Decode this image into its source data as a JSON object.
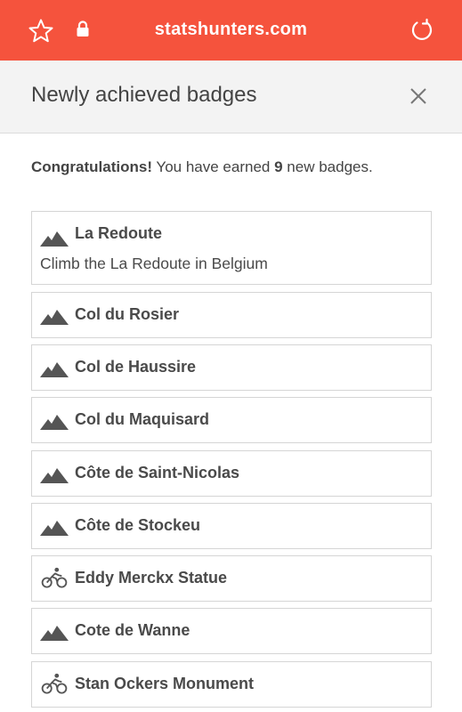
{
  "browser": {
    "url": "statshunters.com",
    "accent_color": "#f5533d",
    "icons": [
      "star-icon",
      "lock-icon",
      "reload-icon"
    ]
  },
  "modal": {
    "title": "Newly achieved badges",
    "close_icon": "close-icon",
    "congrats_strong": "Congratulations!",
    "congrats_text_before": "You have earned",
    "badge_count": "9",
    "congrats_text_after": "new badges."
  },
  "badges": [
    {
      "name": "La Redoute",
      "description": "Climb the La Redoute in Belgium",
      "icon": "mountain-icon"
    },
    {
      "name": "Col du Rosier",
      "icon": "mountain-icon"
    },
    {
      "name": "Col de Haussire",
      "icon": "mountain-icon"
    },
    {
      "name": "Col du Maquisard",
      "icon": "mountain-icon"
    },
    {
      "name": "Côte de Saint-Nicolas",
      "icon": "mountain-icon"
    },
    {
      "name": "Côte de Stockeu",
      "icon": "mountain-icon"
    },
    {
      "name": "Eddy Merckx Statue",
      "icon": "cyclist-icon"
    },
    {
      "name": "Cote de Wanne",
      "icon": "mountain-icon"
    },
    {
      "name": "Stan Ockers Monument",
      "icon": "cyclist-icon"
    }
  ]
}
